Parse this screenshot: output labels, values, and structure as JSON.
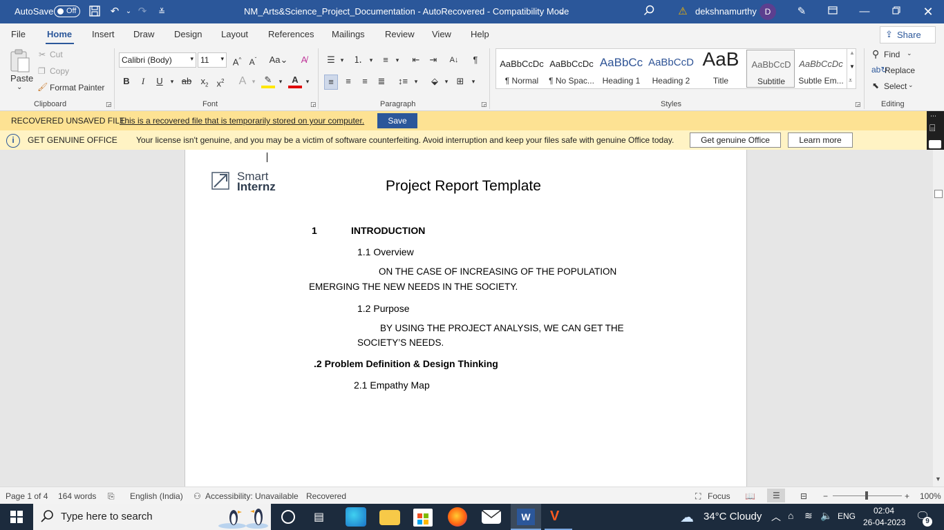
{
  "titlebar": {
    "autosave_label": "AutoSave",
    "autosave_state": "Off",
    "document_title": "NM_Arts&Science_Project_Documentation  -  AutoRecovered  -  Compatibility Mode",
    "username": "dekshnamurthy",
    "avatar_initial": "D"
  },
  "ribbon_tabs": [
    "File",
    "Home",
    "Insert",
    "Draw",
    "Design",
    "Layout",
    "References",
    "Mailings",
    "Review",
    "View",
    "Help"
  ],
  "share_label": "Share",
  "clipboard": {
    "paste": "Paste",
    "cut": "Cut",
    "copy": "Copy",
    "format_painter": "Format Painter",
    "group": "Clipboard"
  },
  "font": {
    "name": "Calibri (Body)",
    "size": "11",
    "group": "Font"
  },
  "paragraph": {
    "group": "Paragraph"
  },
  "styles": {
    "group": "Styles",
    "items": [
      {
        "preview": "AaBbCcDc",
        "name": "¶ Normal"
      },
      {
        "preview": "AaBbCcDc",
        "name": "¶ No Spac..."
      },
      {
        "preview": "AaBbCc",
        "name": "Heading 1"
      },
      {
        "preview": "AaBbCcD",
        "name": "Heading 2"
      },
      {
        "preview": "AaB",
        "name": "Title"
      },
      {
        "preview": "AaBbCcD",
        "name": "Subtitle"
      },
      {
        "preview": "AaBbCcDc",
        "name": "Subtle Em..."
      }
    ]
  },
  "editing": {
    "find": "Find",
    "replace": "Replace",
    "select": "Select",
    "group": "Editing"
  },
  "recovered_bar": {
    "title": "RECOVERED UNSAVED FILE",
    "message": "This is a recovered file that is temporarily stored on your computer.",
    "save": "Save"
  },
  "license_bar": {
    "title": "GET GENUINE OFFICE",
    "message": "Your license isn't genuine, and you may be a victim of software counterfeiting. Avoid interruption and keep your files safe with genuine Office today.",
    "get_genuine": "Get genuine Office",
    "learn_more": "Learn more"
  },
  "document": {
    "logo_line1": "Smart",
    "logo_line2": "Internz",
    "title": "Project Report Template",
    "sec1_num": "1",
    "sec1_title": "INTRODUCTION",
    "sub11": "1.1  Overview",
    "p1_line1": "ON THE CASE OF INCREASING OF THE POPULATION",
    "p1_line2": "EMERGING THE NEW NEEDS IN THE SOCIETY.",
    "sub12": "1.2  Purpose",
    "p2_line1": "BY  USING  THE  PROJECT  ANALYSIS,  WE  CAN  GET  THE",
    "p2_line2": "SOCIETY’S NEEDS.",
    "sec2": ".2 Problem Definition & Design Thinking",
    "sub21": "2.1 Empathy Map"
  },
  "statusbar": {
    "page": "Page 1 of 4",
    "words": "164 words",
    "language": "English (India)",
    "accessibility": "Accessibility: Unavailable",
    "recovered": "Recovered",
    "focus": "Focus",
    "zoom": "100%"
  },
  "taskbar": {
    "search_placeholder": "Type here to search",
    "weather": "34°C  Cloudy",
    "lang": "ENG",
    "time": "02:04",
    "date": "26-04-2023",
    "notifications": "9"
  },
  "colors": {
    "accent": "#2b579a",
    "recovered_bar": "#fde293",
    "license_bar": "#fff3c4",
    "taskbar": "#1c2b3d"
  }
}
